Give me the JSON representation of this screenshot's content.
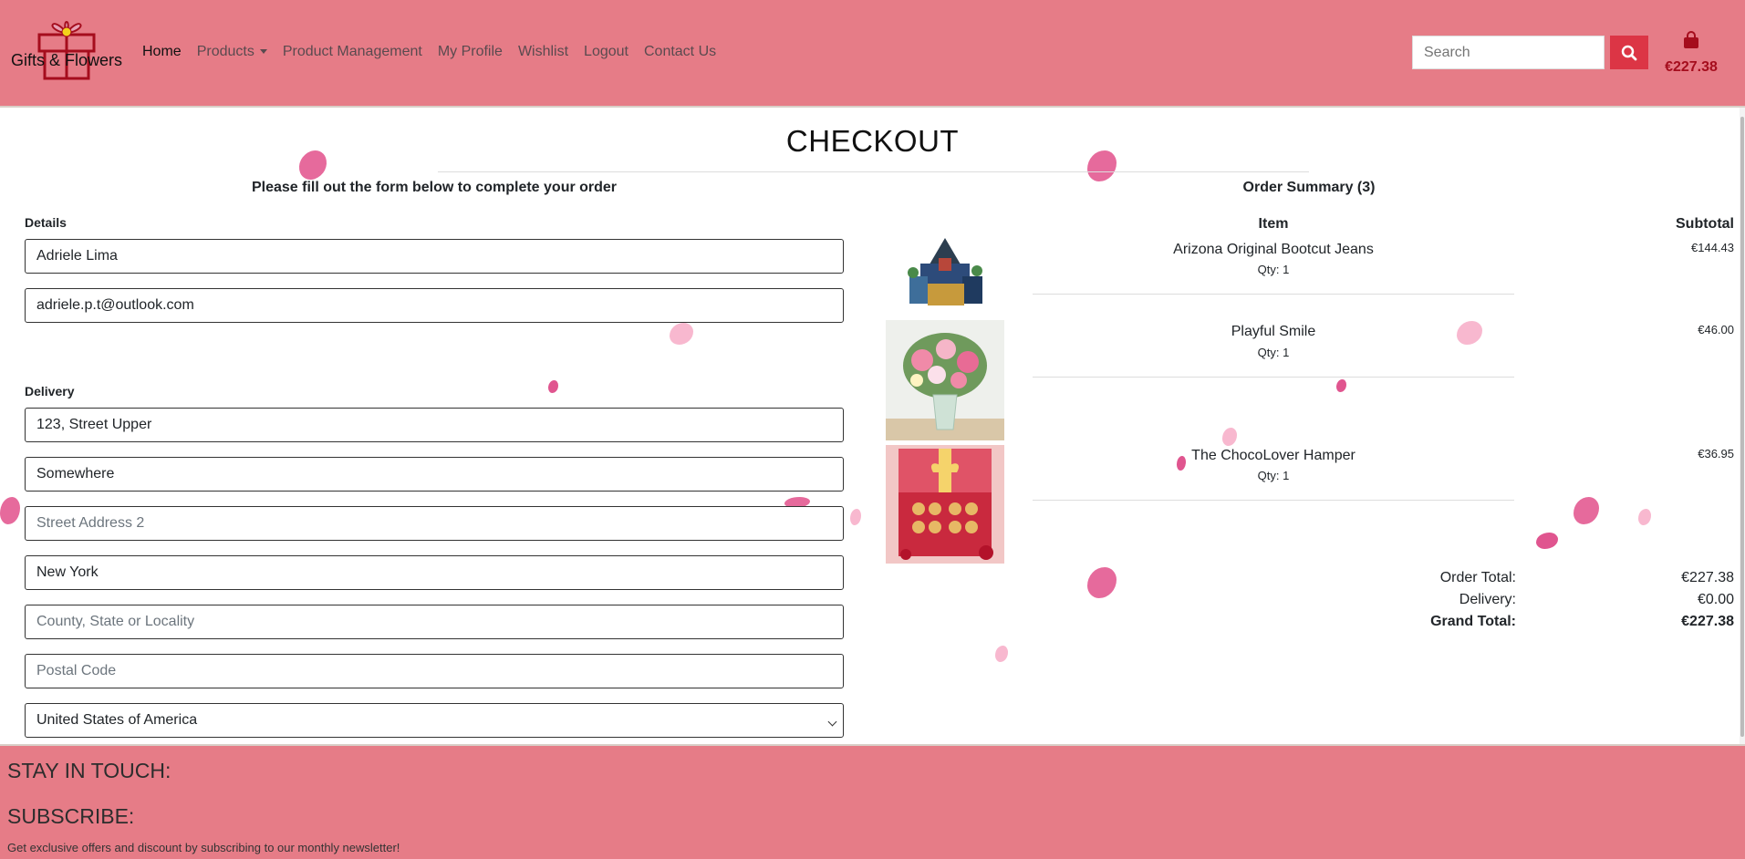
{
  "brand": {
    "name": "Gifts & Flowers",
    "accent": "#e67c87",
    "button": "#dc3545"
  },
  "nav": {
    "home": "Home",
    "products": "Products",
    "product_management": "Product Management",
    "my_profile": "My Profile",
    "wishlist": "Wishlist",
    "logout": "Logout",
    "contact_us": "Contact Us"
  },
  "search": {
    "placeholder": "Search",
    "icon": "search-icon"
  },
  "bag": {
    "icon": "shopping-bag-icon",
    "total": "€227.38"
  },
  "page": {
    "title": "CHECKOUT",
    "intro": "Please fill out the form below to complete your order"
  },
  "form": {
    "details_label": "Details",
    "full_name": "Adriele Lima",
    "email": "adriele.p.t@outlook.com",
    "delivery_label": "Delivery",
    "street1": "123, Street Upper",
    "town_area": "Somewhere",
    "street2_placeholder": "Street Address 2",
    "city": "New York",
    "county_placeholder": "County, State or Locality",
    "postcode_placeholder": "Postal Code",
    "country": "United States of America"
  },
  "summary": {
    "title": "Order Summary (3)",
    "col_item": "Item",
    "col_subtotal": "Subtotal",
    "items": [
      {
        "name": "Arizona Original Bootcut Jeans",
        "qty": "Qty: 1",
        "subtotal": "€144.43"
      },
      {
        "name": "Playful Smile",
        "qty": "Qty: 1",
        "subtotal": "€46.00"
      },
      {
        "name": "The ChocoLover Hamper",
        "qty": "Qty: 1",
        "subtotal": "€36.95"
      }
    ],
    "order_total_label": "Order Total:",
    "order_total": "€227.38",
    "delivery_label": "Delivery:",
    "delivery": "€0.00",
    "grand_total_label": "Grand Total:",
    "grand_total": "€227.38"
  },
  "footer": {
    "stay_in_touch": "STAY IN TOUCH:",
    "subscribe": "SUBSCRIBE:",
    "newsletter_text": "Get exclusive offers and discount by subscribing to our monthly newsletter!"
  }
}
